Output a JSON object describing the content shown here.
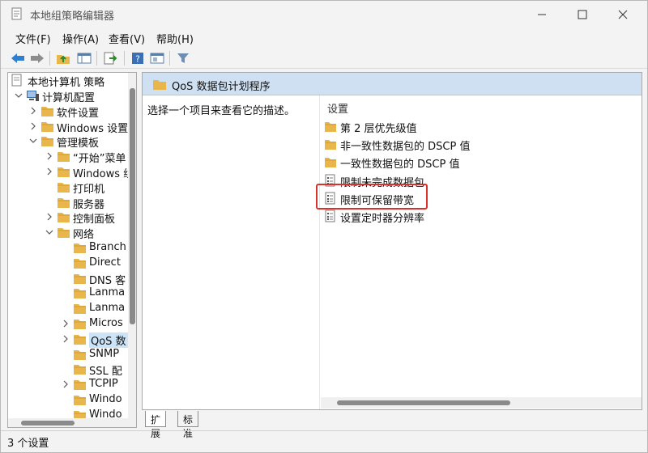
{
  "window": {
    "title": "本地组策略编辑器"
  },
  "menu": [
    "文件(F)",
    "操作(A)",
    "查看(V)",
    "帮助(H)"
  ],
  "toolbar": [
    "back-icon",
    "forward-icon",
    "up-folder-icon",
    "show-hide-tree-icon",
    "export-list-icon",
    "help-icon",
    "view-icon",
    "filter-icon"
  ],
  "tree": {
    "root": "本地计算机 策略",
    "items": [
      {
        "label": "计算机配置"
      },
      {
        "label": "软件设置"
      },
      {
        "label": "Windows 设置"
      },
      {
        "label": "管理模板"
      },
      {
        "label": "“开始”菜单"
      },
      {
        "label": "Windows 组件"
      },
      {
        "label": "打印机"
      },
      {
        "label": "服务器"
      },
      {
        "label": "控制面板"
      },
      {
        "label": "网络"
      },
      {
        "label": "Branch"
      },
      {
        "label": "Direct"
      },
      {
        "label": "DNS 客"
      },
      {
        "label": "Lanma"
      },
      {
        "label": "Lanma"
      },
      {
        "label": "Micros"
      },
      {
        "label": "QoS 数"
      },
      {
        "label": "SNMP"
      },
      {
        "label": "SSL 配"
      },
      {
        "label": "TCPIP"
      },
      {
        "label": "Windo"
      },
      {
        "label": "Windo"
      }
    ]
  },
  "right": {
    "header": "QoS 数据包计划程序",
    "description": "选择一个项目来查看它的描述。",
    "column": "设置",
    "rows": [
      {
        "label": "第 2 层优先级值",
        "icon": "folder-icon"
      },
      {
        "label": "非一致性数据包的 DSCP 值",
        "icon": "folder-icon"
      },
      {
        "label": "一致性数据包的 DSCP 值",
        "icon": "folder-icon"
      },
      {
        "label": "限制未完成数据包",
        "icon": "setting-icon"
      },
      {
        "label": "限制可保留带宽",
        "icon": "setting-icon"
      },
      {
        "label": "设置定时器分辨率",
        "icon": "setting-icon"
      }
    ]
  },
  "tabs": [
    "扩展",
    "标准"
  ],
  "status": "3 个设置",
  "colors": {
    "highlight": "#d9322b",
    "header_bg": "#cfe0f2",
    "folder": "#e8b64a"
  }
}
